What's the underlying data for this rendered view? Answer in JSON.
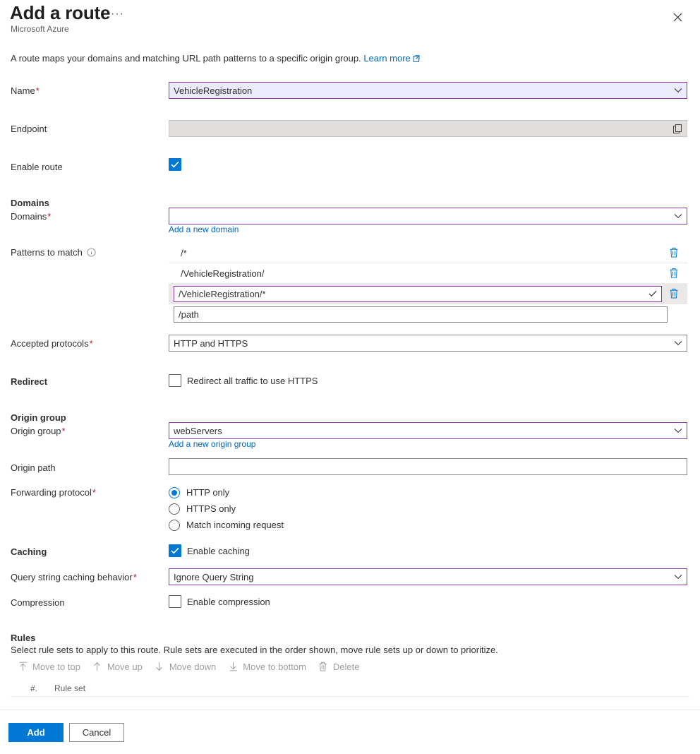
{
  "header": {
    "title": "Add a route",
    "subtitle": "Microsoft Azure",
    "ellipsis": "···",
    "close_icon": "close-icon"
  },
  "intro": {
    "text": "A route maps your domains and matching URL path patterns to a specific origin group.",
    "link_label": "Learn more",
    "link_icon": "external-link-icon"
  },
  "fields": {
    "name": {
      "label": "Name",
      "required": "*",
      "value": "VehicleRegistration",
      "state": "focused",
      "adorn_icon": "chevron-down-icon"
    },
    "endpoint": {
      "label": "Endpoint",
      "value": "",
      "state": "disabled",
      "adorn_icon": "copy-icon"
    },
    "enable_route": {
      "label": "Enable route",
      "checked": true
    },
    "domains_section": "Domains",
    "domains": {
      "label": "Domains",
      "required": "*",
      "value": "",
      "state": "purple",
      "adorn_icon": "chevron-down-icon",
      "add_link": "Add a new domain"
    },
    "patterns": {
      "label": "Patterns to match",
      "info_icon": "info-icon",
      "rows": [
        {
          "value": "/*",
          "editable": false,
          "selected": false,
          "delete_icon": "delete-icon"
        },
        {
          "value": "/VehicleRegistration/",
          "editable": false,
          "selected": false,
          "delete_icon": "delete-icon"
        },
        {
          "value": "/VehicleRegistration/*",
          "editable": true,
          "selected": true,
          "delete_icon": "delete-icon",
          "adorn_icon": "check-icon"
        }
      ],
      "new_placeholder": "/path"
    },
    "accepted_protocols": {
      "label": "Accepted protocols",
      "required": "*",
      "value": "HTTP and HTTPS",
      "adorn_icon": "chevron-down-icon"
    },
    "redirect": {
      "label": "Redirect",
      "checkbox_label": "Redirect all traffic to use HTTPS",
      "checked": false
    },
    "origin_group_section": "Origin group",
    "origin_group": {
      "label": "Origin group",
      "required": "*",
      "value": "webServers",
      "state": "purple",
      "adorn_icon": "chevron-down-icon",
      "add_link": "Add a new origin group"
    },
    "origin_path": {
      "label": "Origin path",
      "value": ""
    },
    "forwarding_protocol": {
      "label": "Forwarding protocol",
      "required": "*",
      "options": [
        {
          "label": "HTTP only",
          "selected": true
        },
        {
          "label": "HTTPS only",
          "selected": false
        },
        {
          "label": "Match incoming request",
          "selected": false
        }
      ]
    },
    "caching": {
      "label": "Caching",
      "checkbox_label": "Enable caching",
      "checked": true
    },
    "query_string": {
      "label": "Query string caching behavior",
      "required": "*",
      "value": "Ignore Query String",
      "state": "purple",
      "adorn_icon": "chevron-down-icon"
    },
    "compression": {
      "label": "Compression",
      "checkbox_label": "Enable compression",
      "checked": false
    }
  },
  "rules": {
    "heading": "Rules",
    "description": "Select rule sets to apply to this route. Rule sets are executed in the order shown, move rule sets up or down to prioritize.",
    "commands": [
      {
        "label": "Move to top",
        "icon": "move-to-top-icon",
        "enabled": false
      },
      {
        "label": "Move up",
        "icon": "move-up-icon",
        "enabled": false
      },
      {
        "label": "Move down",
        "icon": "move-down-icon",
        "enabled": false
      },
      {
        "label": "Move to bottom",
        "icon": "move-to-bottom-icon",
        "enabled": false
      },
      {
        "label": "Delete",
        "icon": "delete-icon",
        "enabled": false
      }
    ],
    "columns": [
      "#.",
      "Rule set"
    ],
    "rows": []
  },
  "footer": {
    "add_label": "Add",
    "cancel_label": "Cancel"
  },
  "colors": {
    "accent": "#0078d4",
    "link": "#0067b8",
    "required": "#a4262c",
    "focus_border": "#8a3ba5",
    "focus_fill": "#eceafd"
  }
}
